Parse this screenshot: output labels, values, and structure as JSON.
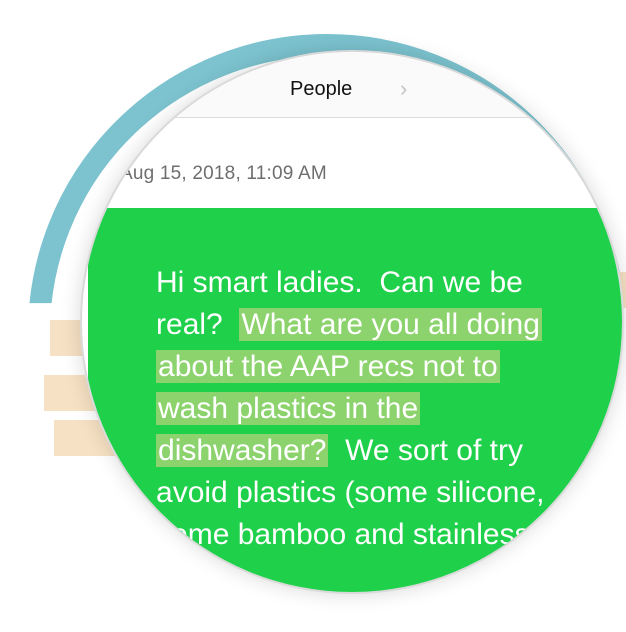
{
  "nav": {
    "title": "People",
    "chevron_icon": "chevron-right-icon"
  },
  "message": {
    "timestamp": "Aug 15, 2018, 11:09 AM",
    "lines": [
      {
        "plain": "Hi smart ladies.  Can we be",
        "hl": ""
      },
      {
        "plain": "real?  ",
        "hl": "What are you all doing"
      },
      {
        "plain": "",
        "hl": "about the AAP recs not to"
      },
      {
        "plain": "",
        "hl": "wash plastics in the"
      },
      {
        "plain": "",
        "hl": "dishwasher?",
        "after": "  We sort of try"
      },
      {
        "plain": "avoid plastics (some silicone,",
        "hl": ""
      },
      {
        "plain": "some bamboo and stainless",
        "hl": ""
      }
    ],
    "bubble_color": "#1fd04a",
    "highlight_color": "#e6d68c"
  },
  "decor": {
    "ring_color": "#7cc3cf",
    "band_color": "#f7e1c4"
  }
}
